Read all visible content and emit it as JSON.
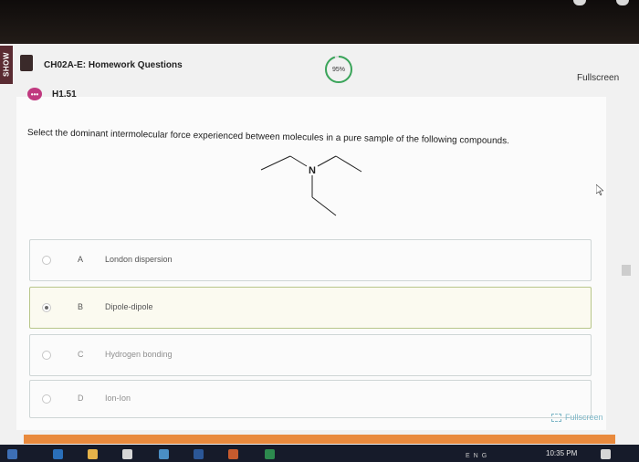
{
  "side_tab_label": "SHOW",
  "header": {
    "title": "CH02A-E: Homework Questions",
    "progress_text": "95%",
    "progress_value": 0.95,
    "fullscreen_label": "Fullscreen"
  },
  "question": {
    "id": "H1.51",
    "badge": "•••",
    "prompt": "Select the dominant intermolecular force experienced between molecules in a pure sample of the following compounds.",
    "molecule_atom_label": "N"
  },
  "choices": [
    {
      "letter": "A",
      "text": "London dispersion",
      "selected": false
    },
    {
      "letter": "B",
      "text": "Dipole-dipole",
      "selected": true
    },
    {
      "letter": "C",
      "text": "Hydrogen bonding",
      "selected": false
    },
    {
      "letter": "D",
      "text": "Ion-Ion",
      "selected": false
    }
  ],
  "footer": {
    "fullscreen_label": "Fullscreen"
  },
  "taskbar": {
    "clock": "10:35 PM",
    "tray_text": "ENG"
  },
  "colors": {
    "accent_orange": "#e98a3d",
    "progress_green": "#3aa55a",
    "badge_pink": "#c0397f",
    "selected_border": "#b8c68a"
  }
}
